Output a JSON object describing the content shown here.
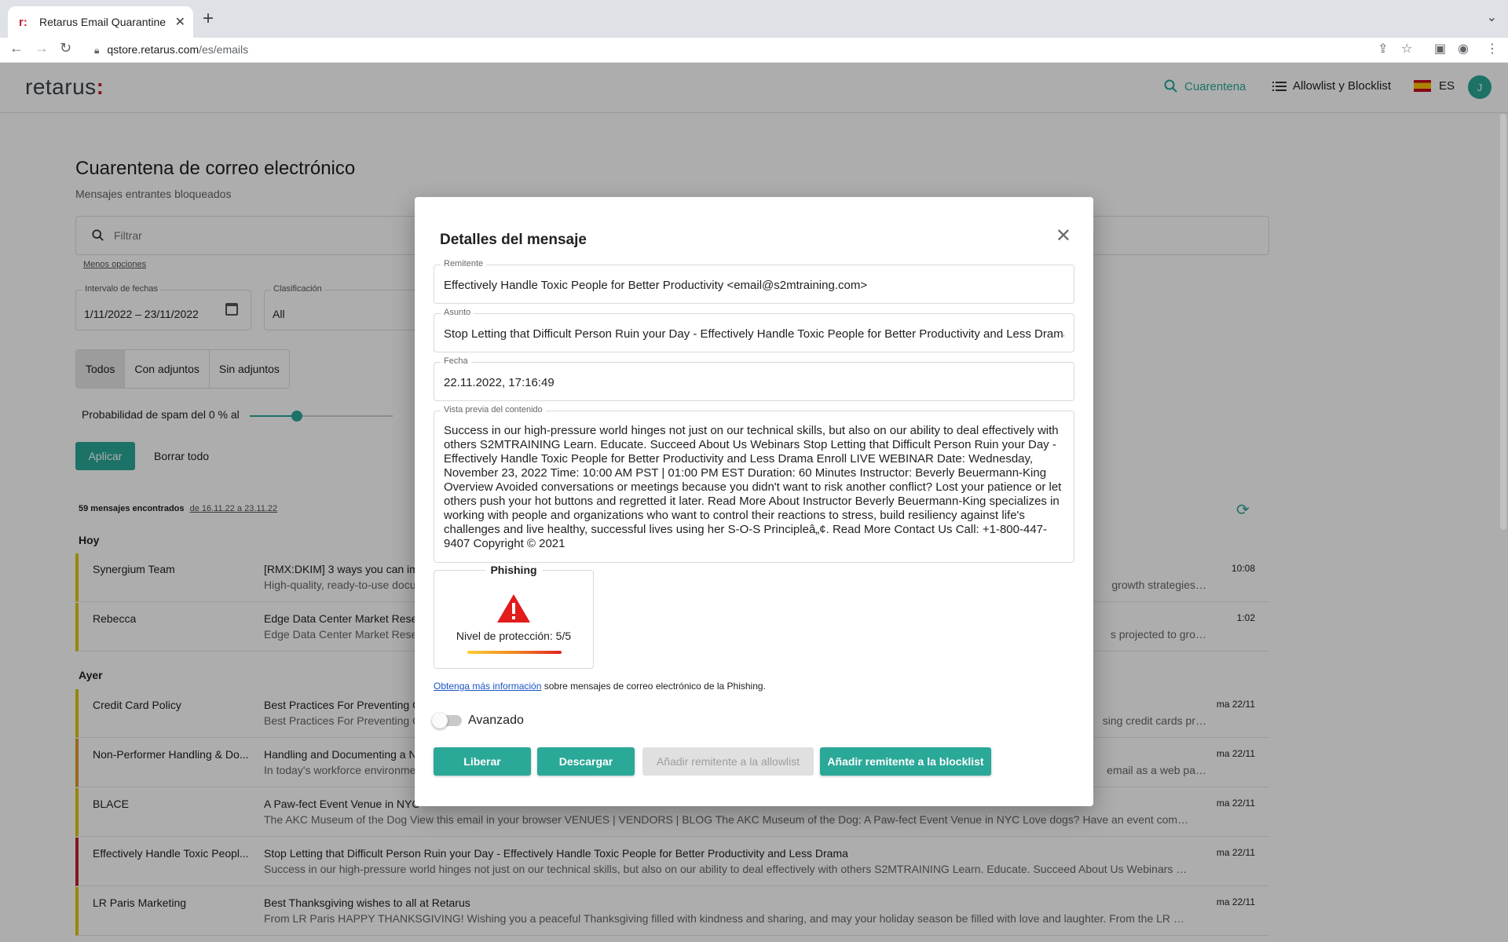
{
  "browser": {
    "tab_title": "Retarus Email Quarantine | Email",
    "url_host": "qstore.retarus.com",
    "url_path": "/es/emails"
  },
  "header": {
    "logo": "retarus",
    "logo_dots": ":",
    "nav_quarantine": "Cuarentena",
    "nav_lists": "Allowlist y Blocklist",
    "lang": "ES",
    "avatar_initial": "J"
  },
  "page": {
    "title": "Cuarentena de correo electrónico",
    "subtitle": "Mensajes entrantes bloqueados",
    "filter_placeholder": "Filtrar",
    "fewer_options": "Menos opciones",
    "date_label": "Intervalo de fechas",
    "date_value": "1/11/2022 – 23/11/2022",
    "class_label": "Clasificación",
    "class_value": "All",
    "segments": [
      "Todos",
      "Con adjuntos",
      "Sin adjuntos"
    ],
    "spam_label": "Probabilidad de spam del 0 % al",
    "spam_slider_fraction": 0.33,
    "apply": "Aplicar",
    "clear": "Borrar todo",
    "found_count": "59 mensajes encontrados",
    "found_range": "de 16.11.22 a 23.11.22",
    "group_today": "Hoy",
    "group_yesterday": "Ayer",
    "rows_today": [
      {
        "sender": "Synergium Team",
        "subject": "[RMX:DKIM] 3 ways you can im",
        "preview": "High-quality, ready-to-use docu",
        "time": "10:08",
        "tail": "growth strategies…"
      },
      {
        "sender": "Rebecca",
        "subject": "Edge Data Center Market Resea",
        "preview": "Edge Data Center Market Resea",
        "time": "1:02",
        "tail": "s projected to gro…"
      }
    ],
    "rows_yesterday": [
      {
        "sender": "Credit Card Policy",
        "subject": "Best Practices For Preventing C",
        "preview": "Best Practices For Preventing C",
        "time": "ma 22/11",
        "tail": "sing credit cards pr…"
      },
      {
        "sender": "Non-Performer Handling & Do...",
        "subject": "Handling and Documenting a N",
        "preview": "In today's workforce environme",
        "time": "ma 22/11",
        "tail": "email as a web pa…"
      },
      {
        "sender": "BLACE",
        "subject": "A Paw-fect Event Venue in NYC",
        "preview": "The AKC Museum of the Dog View this email in your browser VENUES | VENDORS | BLOG The AKC Museum of the Dog: A Paw-fect Event Venue in NYC Love dogs? Have an event coming up…",
        "time": "ma 22/11",
        "tail": ""
      },
      {
        "sender": "Effectively Handle Toxic Peopl...",
        "subject": "Stop Letting that Difficult Person Ruin your Day - Effectively Handle Toxic People for Better Productivity and Less Drama",
        "preview": "Success in our high-pressure world hinges not just on our technical skills, but also on our ability to deal effectively with others S2MTRAINING Learn. Educate. Succeed About Us Webinars St…",
        "time": "ma 22/11",
        "tail": ""
      },
      {
        "sender": "LR Paris Marketing",
        "subject": "Best Thanksgiving wishes to all at Retarus",
        "preview": "From LR Paris HAPPY THANKSGIVING! Wishing you a peaceful Thanksgiving filled with kindness and sharing, and may your holiday season be filled with love and laughter. From the LR Paris…",
        "time": "ma 22/11",
        "tail": ""
      }
    ]
  },
  "modal": {
    "title": "Detalles del mensaje",
    "sender_label": "Remitente",
    "sender_value": "Effectively Handle Toxic People for Better Productivity <email@s2mtraining.com>",
    "subject_label": "Asunto",
    "subject_value": "Stop Letting that Difficult Person Ruin your Day - Effectively Handle Toxic People for Better Productivity and Less Drama",
    "date_label": "Fecha",
    "date_value": "22.11.2022, 17:16:49",
    "preview_label": "Vista previa del contenido",
    "preview_value": "Success in our high-pressure world hinges not just on our technical skills, but also on our ability to deal effectively with others S2MTRAINING Learn. Educate. Succeed About Us Webinars Stop Letting that Difficult Person Ruin your Day - Effectively Handle Toxic People for Better Productivity and Less Drama Enroll LIVE WEBINAR Date: Wednesday, November 23, 2022 Time: 10:00 AM PST | 01:00 PM EST Duration: 60 Minutes Instructor: Beverly Beuermann-King Overview Avoided conversations or meetings because you didn't want to risk another conflict? Lost your patience or let others push your hot buttons and regretted it later. Read More About Instructor Beverly Beuermann-King specializes in working with people and organizations who want to control their reactions to stress, build resiliency against life's challenges and live healthy, successful lives using her S-O-S Principleâ„¢. Read More Contact Us Call: +1-800-447-9407 Copyright © 2021",
    "phishing_title": "Phishing",
    "protection_level": "Nivel de protección: 5/5",
    "more_info_link": "Obtenga más información",
    "more_info_text": " sobre mensajes de correo electrónico de la Phishing.",
    "advanced_label": "Avanzado",
    "btn_release": "Liberar",
    "btn_download": "Descargar",
    "btn_allowlist": "Añadir remitente a la allowlist",
    "btn_blocklist": "Añadir remitente a la blocklist"
  },
  "colors": {
    "accent": "#2aa898",
    "brand_red": "#c0202f"
  }
}
